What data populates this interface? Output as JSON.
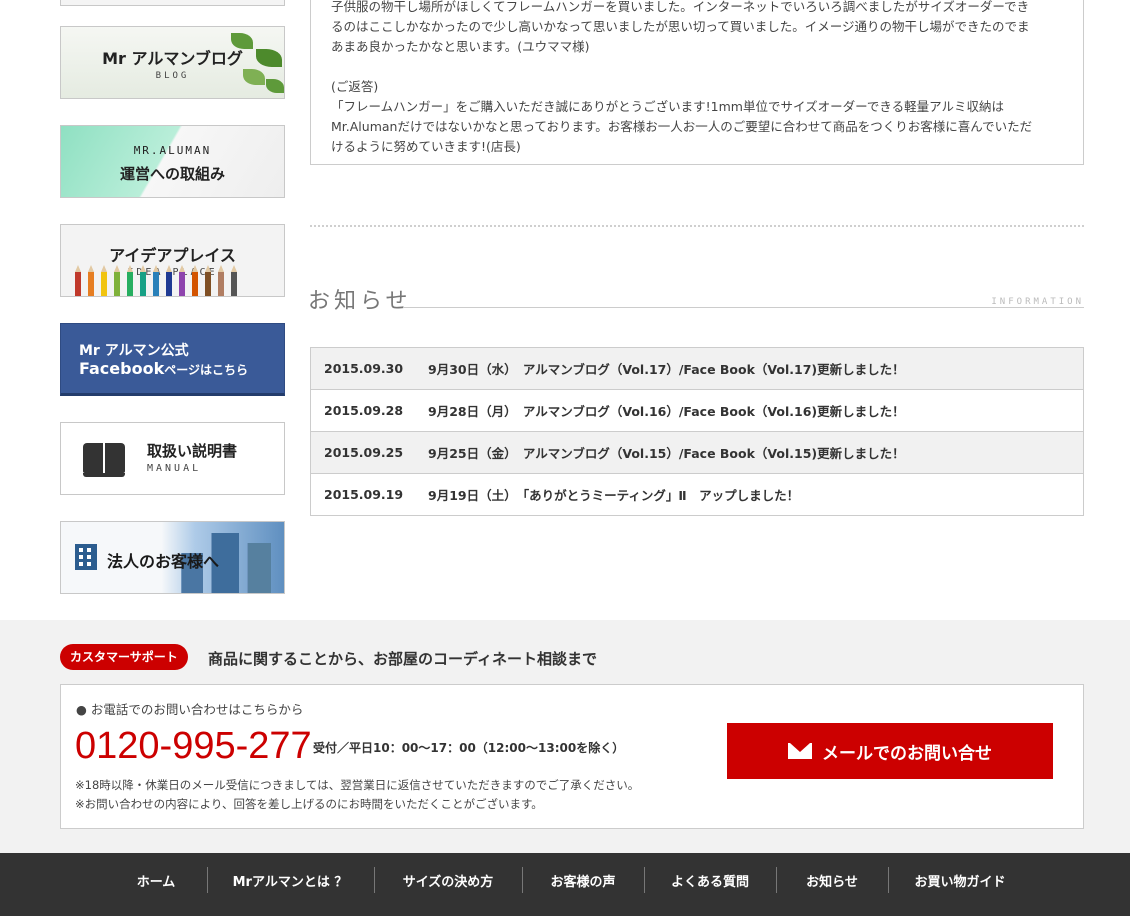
{
  "sidebar": {
    "blog": {
      "title": "Mr アルマンブログ",
      "sub": "BLOG"
    },
    "aluman": {
      "sub": "MR.ALUMAN",
      "title": "運営への取組み"
    },
    "idea": {
      "title": "アイデアプレイス",
      "sub": "IDEA PLACE"
    },
    "facebook": {
      "line1": "Mr アルマン公式",
      "line2_strong": "Facebook",
      "line2_rest": "ページはこちら"
    },
    "manual": {
      "title": "取扱い説明書",
      "sub": "MANUAL"
    },
    "corporate": {
      "title": "法人のお客様へ"
    }
  },
  "voice": {
    "lines": [
      "子供服の物干し場所がほしくてフレームハンガーを買いました。インターネットでいろいろ調べましたがサイズオーダーでき",
      "るのはここしかなかったので少し高いかなって思いましたが思い切って買いました。イメージ通りの物干し場ができたのでま",
      "あまあ良かったかなと思います。(ユウママ様)"
    ],
    "reply_label": "(ご返答)",
    "reply_lines": [
      "「フレームハンガー」をご購入いただき誠にありがとうございます!1mm単位でサイズオーダーできる軽量アルミ収納は",
      "Mr.Alumanだけではないかなと思っております。お客様お一人お一人のご要望に合わせて商品をつくりお客様に喜んでいただ",
      "けるように努めていきます!(店長)"
    ]
  },
  "news": {
    "title": "お知らせ",
    "subtitle": "INFORMATION",
    "items": [
      {
        "date": "2015.09.30",
        "text": "9月30日（水）　アルマンブログ（Vol.17）/Face Book（Vol.17)更新しました！"
      },
      {
        "date": "2015.09.28",
        "text": "9月28日（月）　アルマンブログ（Vol.16）/Face Book（Vol.16)更新しました！"
      },
      {
        "date": "2015.09.25",
        "text": "9月25日（金）　アルマンブログ（Vol.15）/Face Book（Vol.15)更新しました！"
      },
      {
        "date": "2015.09.19",
        "text": "9月19日（土）　「ありがとうミーティング」Ⅱ　アップしました！"
      }
    ]
  },
  "support": {
    "badge": "カスタマーサポート",
    "heading": "商品に関することから、お部屋のコーディネート相談まで",
    "lead": "● お電話でのお問い合わせはこちらから",
    "tel": "0120-995-277",
    "hours": "受付／平日10：00〜17：00（12:00〜13:00を除く）",
    "note1": "※18時以降・休業日のメール受信につきましては、翌営業日に返信させていただきますのでご了承ください。",
    "note2": "※お問い合わせの内容により、回答を差し上げるのにお時間をいただくことがございます。",
    "mail_button": "メールでのお問い合せ"
  },
  "footer_nav": [
    "ホーム",
    "Mrアルマンとは ？",
    "サイズの決め方",
    "お客様の声",
    "よくある質問",
    "お知らせ",
    "お買い物ガイド"
  ],
  "colors": {
    "accent_red": "#cc0000",
    "facebook_blue": "#3a5a98",
    "footer_bg": "#333333"
  }
}
